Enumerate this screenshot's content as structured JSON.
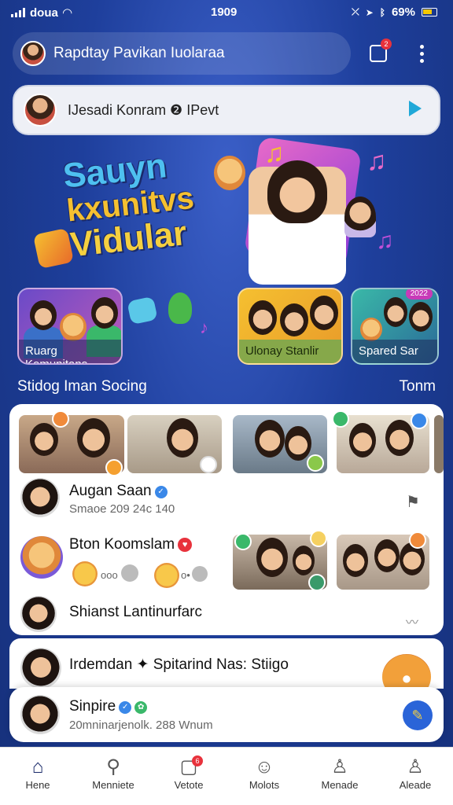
{
  "status_bar": {
    "carrier": "doua",
    "time": "1909",
    "battery": "69%"
  },
  "app_bar": {
    "title": "Rapdtay Pavikan Iuolaraa",
    "notification_count": "2"
  },
  "now_playing": {
    "text": "IJesadi Konram ❷ IPevt"
  },
  "hero": {
    "title_lines": [
      "Sauyn",
      "kxunitvs",
      "Vidular"
    ],
    "tiles": [
      {
        "label": "Ruarg Komunitans"
      },
      {
        "label": "Ulonay Stanlir"
      },
      {
        "label": "Spared Sar",
        "tag": "2022"
      }
    ]
  },
  "section": {
    "title": "Stidog Iman Socing",
    "more": "Tonm"
  },
  "feed": {
    "rows": [
      {
        "name": "Augan Saan",
        "subtitle": "Smaoe 209 24c 140"
      },
      {
        "name": "Bton Koomslam",
        "emoji_counts": [
          "ooo",
          "o•"
        ]
      },
      {
        "name": "Shianst Lantinurfarc"
      }
    ]
  },
  "card2": {
    "text": "Irdemdan ✦ Spitarind Nas: Stiigo"
  },
  "card3": {
    "name": "Sinpire",
    "subtitle": "20mninarjenolk. 288 Wnum"
  },
  "bottom_nav": [
    {
      "label": "Hene",
      "icon": "home-icon",
      "active": true
    },
    {
      "label": "Menniete",
      "icon": "search-icon"
    },
    {
      "label": "Vetote",
      "icon": "video-icon",
      "badge": "6"
    },
    {
      "label": "Molots",
      "icon": "smile-icon"
    },
    {
      "label": "Menade",
      "icon": "profile-icon"
    },
    {
      "label": "Aleade",
      "icon": "person-icon"
    }
  ],
  "colors": {
    "background": "#1e3f9c",
    "accent": "#2a64d8",
    "badge": "#e8323c"
  }
}
